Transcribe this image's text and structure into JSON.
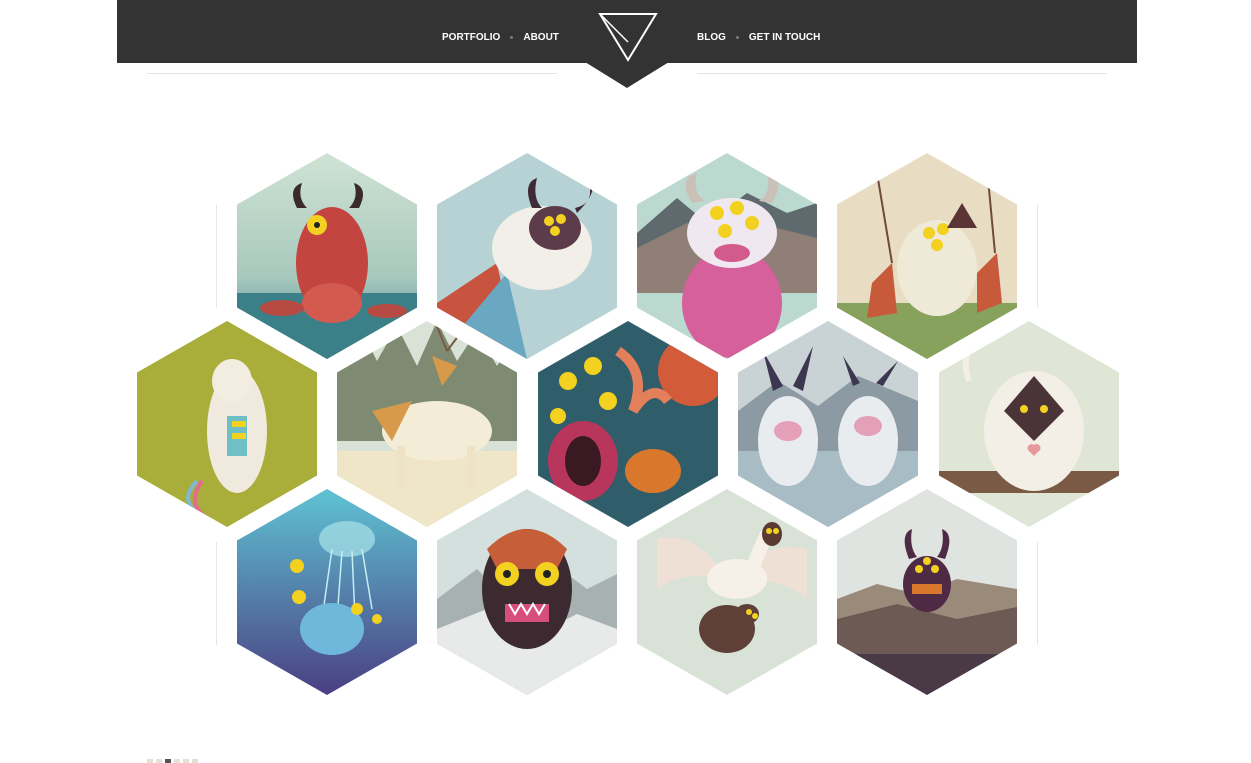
{
  "nav": {
    "left": [
      {
        "label": "PORTFOLIO"
      },
      {
        "label": "ABOUT"
      }
    ],
    "right": [
      {
        "label": "BLOG"
      },
      {
        "label": "GET IN TOUCH"
      }
    ]
  },
  "colors": {
    "header_bg": "#333333",
    "nav_text": "#ffffff",
    "separator_dot": "#7a7a7a",
    "rule": "#e4e4e4"
  },
  "logo": {
    "icon": "triangle-logo-icon"
  },
  "gallery": {
    "items": [
      {
        "subject": "red-horned-monster"
      },
      {
        "subject": "flying-sheep-monster"
      },
      {
        "subject": "pink-cow-monster"
      },
      {
        "subject": "swing-yeti-monster"
      },
      {
        "subject": "lying-unicorn-creature"
      },
      {
        "subject": "white-deer-creatures"
      },
      {
        "subject": "octopus-eyes-monster"
      },
      {
        "subject": "two-horned-yetis"
      },
      {
        "subject": "white-ape-masked"
      },
      {
        "subject": "jellyfish-underwater"
      },
      {
        "subject": "tiki-mask-monster"
      },
      {
        "subject": "goose-carrying-sheep"
      },
      {
        "subject": "horned-creature-lake"
      }
    ]
  },
  "pager": {
    "count": 6,
    "active_index": 3
  }
}
